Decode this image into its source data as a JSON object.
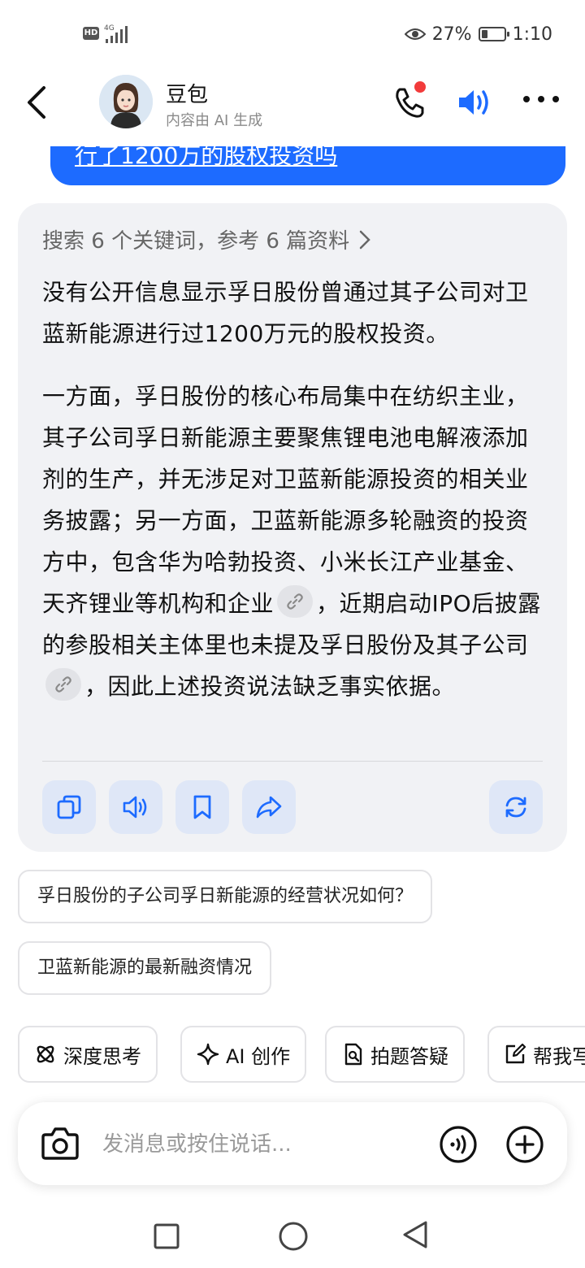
{
  "status_bar": {
    "hd": "HD",
    "network": "4G",
    "battery_percent": "27%",
    "battery_level": 0.27,
    "time": "1:10"
  },
  "header": {
    "title": "豆包",
    "subtitle": "内容由 AI 生成"
  },
  "user_message": {
    "visible_text": "行了1200万的股权投资吗"
  },
  "ai_reply": {
    "search_summary": "搜索 6 个关键词，参考 6 篇资料",
    "paragraph_1": "没有公开信息显示孚日股份曾通过其子公司对卫蓝新能源进行过1200万元的股权投资。",
    "paragraph_2_part_1": "一方面，孚日股份的核心布局集中在纺织主业，其子公司孚日新能源主要聚焦锂电池电解液添加剂的生产，并无涉足对卫蓝新能源投资的相关业务披露；另一方面，卫蓝新能源多轮融资的投资方中，包含华为哈勃投资、小米长江产业基金、天齐锂业等机构和企业",
    "paragraph_2_part_2": "，近期启动IPO后披露的参股相关主体里也未提及孚日股份及其子公司",
    "paragraph_2_part_3": "，因此上述投资说法缺乏事实依据。"
  },
  "suggestions": [
    "孚日股份的子公司孚日新能源的经营状况如何？",
    "卫蓝新能源的最新融资情况"
  ],
  "tools": [
    {
      "label": "深度思考",
      "icon": "atom-icon"
    },
    {
      "label": "AI 创作",
      "icon": "sparkle-icon"
    },
    {
      "label": "拍题答疑",
      "icon": "photo-question-icon"
    },
    {
      "label": "帮我写",
      "icon": "edit-icon"
    }
  ],
  "input": {
    "placeholder": "发消息或按住说话..."
  },
  "colors": {
    "accent": "#1d6bff",
    "card_bg": "#f1f2f5",
    "action_bg": "#dfe7f7",
    "notification_dot": "#f23b3b"
  }
}
